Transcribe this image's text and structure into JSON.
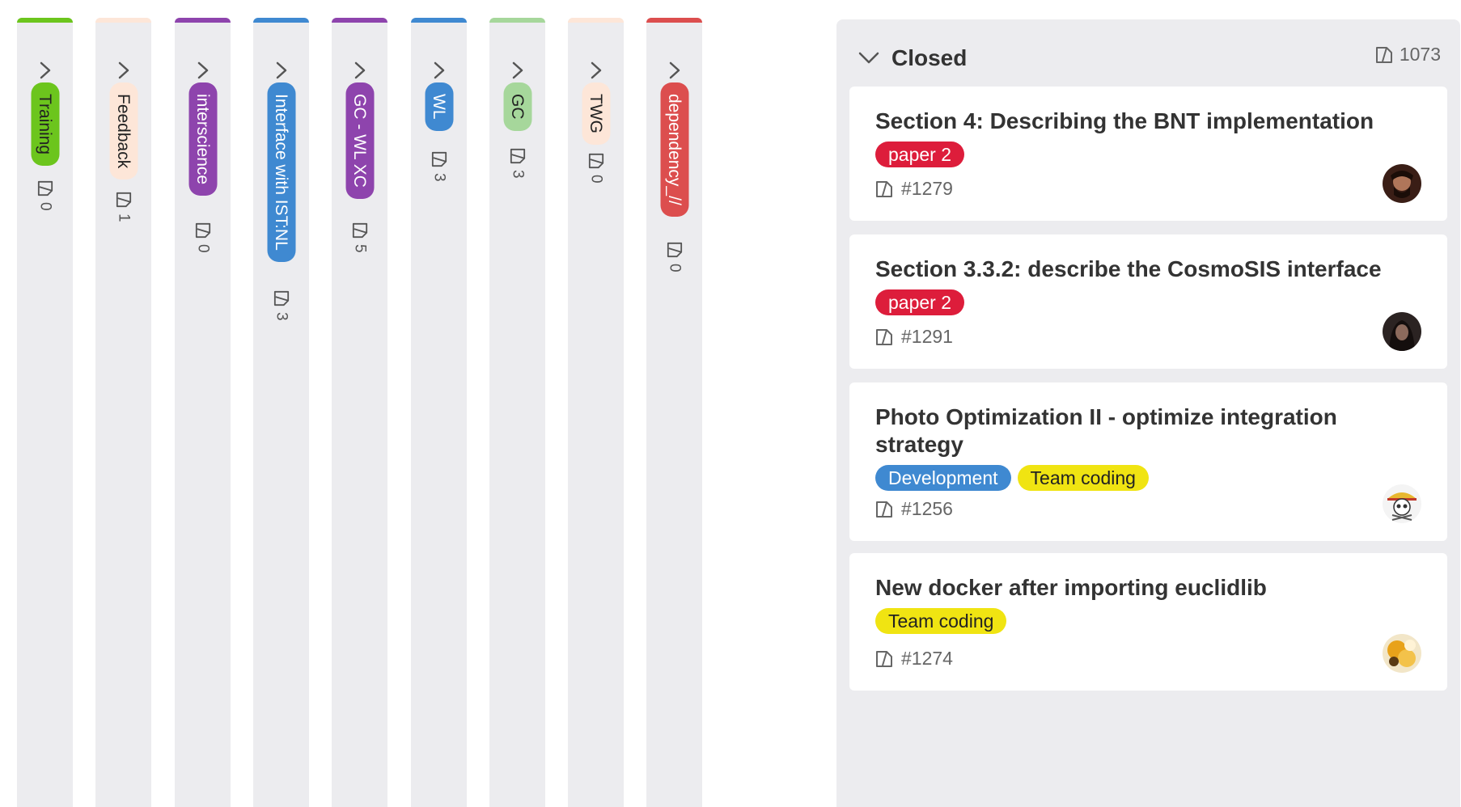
{
  "columns": [
    {
      "label": "Training",
      "count": "0",
      "bar_color": "#6cc51d",
      "pill_bg": "#6cc51d",
      "pill_fg": "#222222"
    },
    {
      "label": "Feedback",
      "count": "1",
      "bar_color": "#fde6d8",
      "pill_bg": "#fde6d8",
      "pill_fg": "#222222"
    },
    {
      "label": "interscience",
      "count": "0",
      "bar_color": "#8e44ad",
      "pill_bg": "#8e44ad",
      "pill_fg": "#ffffff"
    },
    {
      "label": "Interface with IST:NL",
      "count": "3",
      "bar_color": "#3f89d1",
      "pill_bg": "#3f89d1",
      "pill_fg": "#ffffff"
    },
    {
      "label": "GC - WL XC",
      "count": "5",
      "bar_color": "#8e44ad",
      "pill_bg": "#8e44ad",
      "pill_fg": "#ffffff"
    },
    {
      "label": "WL",
      "count": "3",
      "bar_color": "#3f89d1",
      "pill_bg": "#3f89d1",
      "pill_fg": "#ffffff"
    },
    {
      "label": "GC",
      "count": "3",
      "bar_color": "#a6d79b",
      "pill_bg": "#a6d79b",
      "pill_fg": "#222222"
    },
    {
      "label": "TWG",
      "count": "0",
      "bar_color": "#fde6d8",
      "pill_bg": "#fde6d8",
      "pill_fg": "#222222"
    },
    {
      "label": "dependency_//",
      "count": "0",
      "bar_color": "#dc4e4e",
      "pill_bg": "#dc4e4e",
      "pill_fg": "#ffffff"
    }
  ],
  "closed": {
    "title": "Closed",
    "count": "1073",
    "cards": [
      {
        "title": "Section 4: Describing the BNT implementation",
        "tags": [
          {
            "label": "paper 2",
            "bg": "#dd1d3b",
            "fg": "#ffffff"
          }
        ],
        "ref": "#1279",
        "avatar": "dark-bearded"
      },
      {
        "title": "Section 3.3.2: describe the CosmoSIS interface",
        "tags": [
          {
            "label": "paper 2",
            "bg": "#dd1d3b",
            "fg": "#ffffff"
          }
        ],
        "ref": "#1291",
        "avatar": "dark-hair"
      },
      {
        "title": "Photo Optimization II - optimize integration strategy",
        "tags": [
          {
            "label": "Development",
            "bg": "#3f89d1",
            "fg": "#ffffff"
          },
          {
            "label": "Team coding",
            "bg": "#f0e412",
            "fg": "#222222"
          }
        ],
        "ref": "#1256",
        "avatar": "skull-flag"
      },
      {
        "title": "New docker after importing euclidlib",
        "tags": [
          {
            "label": "Team coding",
            "bg": "#f0e412",
            "fg": "#222222"
          }
        ],
        "ref": "#1274",
        "avatar": "orange-blur"
      }
    ]
  }
}
